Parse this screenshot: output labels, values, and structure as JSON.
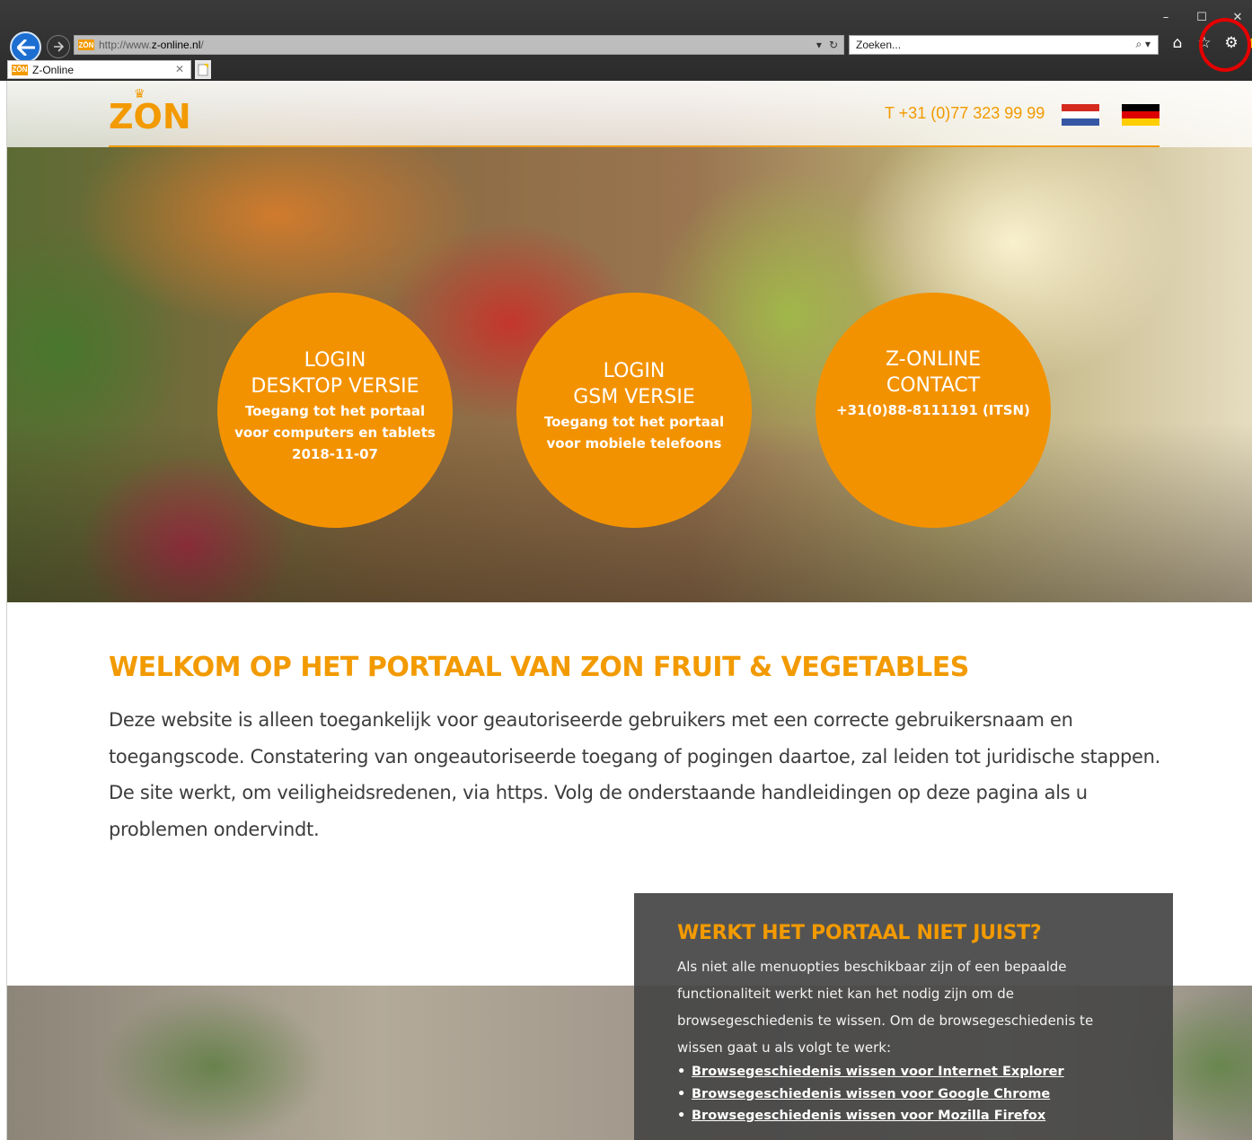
{
  "browser": {
    "address": {
      "prefix": "http://www.",
      "host": "z-online.nl",
      "suffix": "/"
    },
    "address_tools": {
      "dropdown": "▾",
      "refresh": "↻"
    },
    "search": {
      "placeholder": "Zoeken...",
      "tools": "⌕ ▾"
    },
    "tab": {
      "title": "Z-Online",
      "close": "✕"
    },
    "favicon_label": "ZŌN",
    "window_controls": {
      "minimize": "–",
      "maximize": "☐",
      "close": "✕"
    },
    "icons": [
      "home-icon",
      "favorites-star-icon",
      "tools-gear-icon",
      "feedback-smiley-icon"
    ]
  },
  "header": {
    "logo": "ZON",
    "phone": "T +31 (0)77 323 99 99",
    "flags": [
      "nl-flag",
      "de-flag"
    ]
  },
  "circles": [
    {
      "title1": "LOGIN",
      "title2": "DESKTOP VERSIE",
      "sub1": "Toegang tot het portaal",
      "sub2": "voor computers en tablets",
      "sub3": "2018-11-07"
    },
    {
      "title1": "LOGIN",
      "title2": "GSM VERSIE",
      "sub1": "Toegang tot het portaal",
      "sub2": "voor mobiele telefoons"
    },
    {
      "title1": "Z-ONLINE",
      "title2": "CONTACT",
      "sub1": "+31(0)88-8111191 (ITSN)"
    }
  ],
  "welcome": {
    "title": "WELKOM OP HET PORTAAL VAN ZON FRUIT & VEGETABLES",
    "text": "Deze website is alleen toegankelijk voor geautoriseerde gebruikers met een correcte gebruikersnaam en toegangscode. Constatering van ongeautoriseerde toegang of pogingen daartoe, zal leiden tot juridische stappen. De site werkt, om veiligheidsredenen, via https. Volg de onderstaande handleidingen op deze pagina als u problemen ondervindt."
  },
  "info": {
    "title": "WERKT HET PORTAAL NIET JUIST?",
    "text": "Als niet alle menuopties beschikbaar zijn of een bepaalde functionaliteit werkt niet kan het nodig zijn om de browsegeschiedenis te wissen. Om de browsegeschiedenis te wissen gaat u als volgt te werk:",
    "links": [
      "Browsegeschiedenis wissen voor Internet Explorer",
      "Browsegeschiedenis wissen voor Google Chrome",
      "Browsegeschiedenis wissen voor Mozilla Firefox"
    ]
  },
  "colors": {
    "accent": "#f39200",
    "info_bg": "#464646",
    "chrome_bg": "#2b2b2b"
  }
}
